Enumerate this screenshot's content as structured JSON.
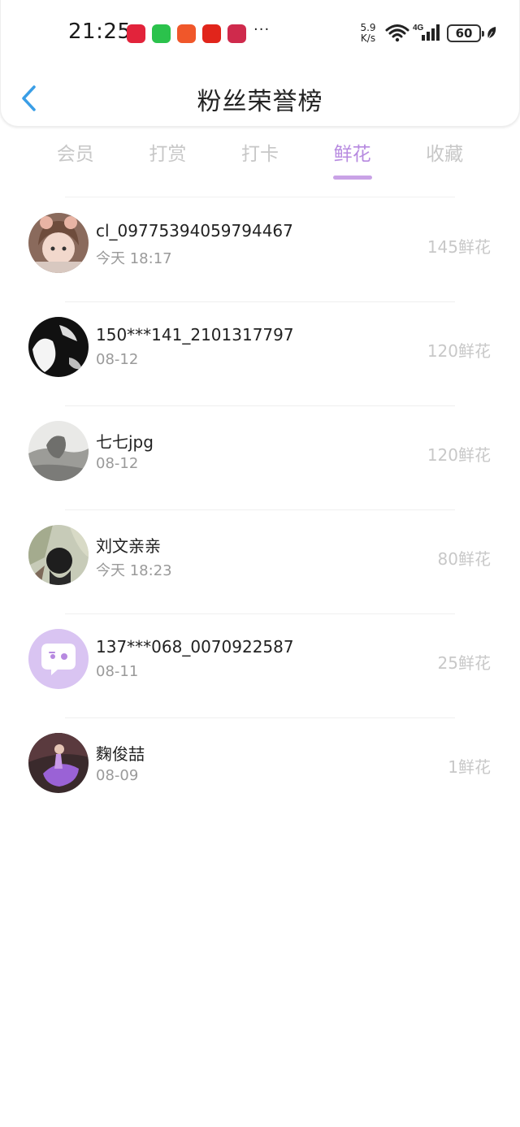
{
  "status_bar": {
    "time": "21:25",
    "more": "···",
    "net_speed_value": "5.9",
    "net_speed_unit": "K/s",
    "network_type": "4G",
    "battery_level": "60",
    "app_icons": [
      "tmall-icon",
      "wechat-icon",
      "taobao-icon",
      "jd-icon",
      "huawei-store-icon"
    ]
  },
  "nav": {
    "title": "粉丝荣誉榜"
  },
  "tabs": [
    {
      "label": "会员",
      "active": false
    },
    {
      "label": "打赏",
      "active": false
    },
    {
      "label": "打卡",
      "active": false
    },
    {
      "label": "鲜花",
      "active": true
    },
    {
      "label": "收藏",
      "active": false
    }
  ],
  "fans": [
    {
      "name": "cl_09775394059794467",
      "date": "今天 18:17",
      "count": "145鲜花"
    },
    {
      "name": "150***141_2101317797",
      "date": "08-12",
      "count": "120鲜花"
    },
    {
      "name": "七七jpg",
      "date": "08-12",
      "count": "120鲜花"
    },
    {
      "name": "刘文亲亲",
      "date": "今天 18:23",
      "count": "80鲜花"
    },
    {
      "name": "137***068_0070922587",
      "date": "08-11",
      "count": "25鲜花"
    },
    {
      "name": "麴俊喆",
      "date": "08-09",
      "count": "1鲜花"
    }
  ],
  "colors": {
    "accent": "#b78ae0",
    "tab_inactive": "#c7c7c7",
    "count": "#c8c8c8",
    "back_arrow": "#3a9ee6"
  }
}
